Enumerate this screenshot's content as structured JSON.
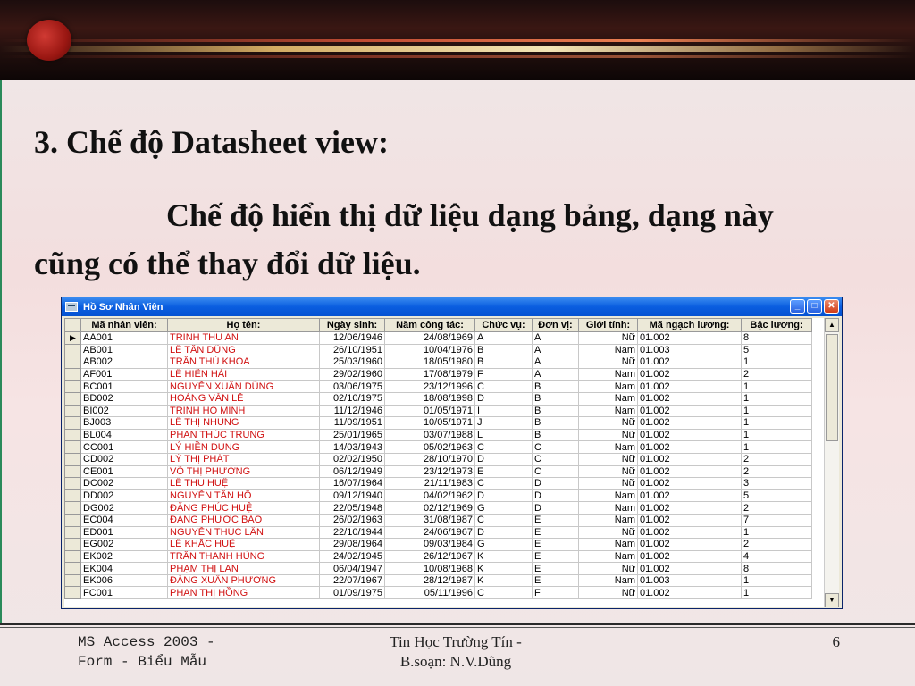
{
  "slide": {
    "heading": "3. Chế độ Datasheet view:",
    "paragraph": "Chế độ hiển thị dữ liệu dạng bảng, dạng này cũng có thể thay đổi dữ liệu."
  },
  "window": {
    "title": "Hồ Sơ Nhân Viên",
    "minimize": "_",
    "maximize": "□",
    "close": "✕",
    "columns": [
      "Mã nhân viên:",
      "Họ tên:",
      "Ngày sinh:",
      "Năm công tác:",
      "Chức vụ:",
      "Đơn vị:",
      "Giới tính:",
      "Mã ngạch lương:",
      "Bậc lương:"
    ],
    "current_row_marker": "▶",
    "rows": [
      [
        "AA001",
        "TRINH THU AN",
        "12/06/1946",
        "24/08/1969",
        "A",
        "A",
        "Nữ",
        "01.002",
        "8"
      ],
      [
        "AB001",
        "LÊ TẤN DŨNG",
        "26/10/1951",
        "10/04/1976",
        "B",
        "A",
        "Nam",
        "01.003",
        "5"
      ],
      [
        "AB002",
        "TRẦN THỦ KHOA",
        "25/03/1960",
        "18/05/1980",
        "B",
        "A",
        "Nữ",
        "01.002",
        "1"
      ],
      [
        "AF001",
        "LÊ HIỀN HẢI",
        "29/02/1960",
        "17/08/1979",
        "F",
        "A",
        "Nam",
        "01.002",
        "2"
      ],
      [
        "BC001",
        "NGUYỄN XUÂN DŨNG",
        "03/06/1975",
        "23/12/1996",
        "C",
        "B",
        "Nam",
        "01.002",
        "1"
      ],
      [
        "BD002",
        "HOÀNG VĂN LỄ",
        "02/10/1975",
        "18/08/1998",
        "D",
        "B",
        "Nam",
        "01.002",
        "1"
      ],
      [
        "BI002",
        "TRINH HỒ MINH",
        "11/12/1946",
        "01/05/1971",
        "I",
        "B",
        "Nam",
        "01.002",
        "1"
      ],
      [
        "BJ003",
        "LÊ THỊ NHUNG",
        "11/09/1951",
        "10/05/1971",
        "J",
        "B",
        "Nữ",
        "01.002",
        "1"
      ],
      [
        "BL004",
        "PHAN THÚC TRUNG",
        "25/01/1965",
        "03/07/1988",
        "L",
        "B",
        "Nữ",
        "01.002",
        "1"
      ],
      [
        "CC001",
        "LÝ HIỀN DUNG",
        "14/03/1943",
        "05/02/1963",
        "C",
        "C",
        "Nam",
        "01.002",
        "1"
      ],
      [
        "CD002",
        "LÝ THỊ PHÁT",
        "02/02/1950",
        "28/10/1970",
        "D",
        "C",
        "Nữ",
        "01.002",
        "2"
      ],
      [
        "CE001",
        "VÕ THỊ PHƯƠNG",
        "06/12/1949",
        "23/12/1973",
        "E",
        "C",
        "Nữ",
        "01.002",
        "2"
      ],
      [
        "DC002",
        "LÊ THU HUỆ",
        "16/07/1964",
        "21/11/1983",
        "C",
        "D",
        "Nữ",
        "01.002",
        "3"
      ],
      [
        "DD002",
        "NGUYỄN TẤN HỒ",
        "09/12/1940",
        "04/02/1962",
        "D",
        "D",
        "Nam",
        "01.002",
        "5"
      ],
      [
        "DG002",
        "ĐẶNG PHÚC HUỆ",
        "22/05/1948",
        "02/12/1969",
        "G",
        "D",
        "Nam",
        "01.002",
        "2"
      ],
      [
        "EC004",
        "ĐẶNG PHƯỚC BẢO",
        "26/02/1963",
        "31/08/1987",
        "C",
        "E",
        "Nam",
        "01.002",
        "7"
      ],
      [
        "ED001",
        "NGUYỄN THÚC LÂN",
        "22/10/1944",
        "24/06/1967",
        "D",
        "E",
        "Nữ",
        "01.002",
        "1"
      ],
      [
        "EG002",
        "LÊ KHẮC HUỆ",
        "29/08/1964",
        "09/03/1984",
        "G",
        "E",
        "Nam",
        "01.002",
        "2"
      ],
      [
        "EK002",
        "TRẦN THANH HÙNG",
        "24/02/1945",
        "26/12/1967",
        "K",
        "E",
        "Nam",
        "01.002",
        "4"
      ],
      [
        "EK004",
        "PHẠM THỊ LAN",
        "06/04/1947",
        "10/08/1968",
        "K",
        "E",
        "Nữ",
        "01.002",
        "8"
      ],
      [
        "EK006",
        "ĐẶNG XUÂN PHƯƠNG",
        "22/07/1967",
        "28/12/1987",
        "K",
        "E",
        "Nam",
        "01.003",
        "1"
      ],
      [
        "FC001",
        "PHAN THỊ HỒNG",
        "01/09/1975",
        "05/11/1996",
        "C",
        "F",
        "Nữ",
        "01.002",
        "1"
      ]
    ]
  },
  "footer": {
    "left_line1": "MS Access 2003 -",
    "left_line2": "Form - Biểu Mẫu",
    "mid_line1": "Tin Học Trường Tín -",
    "mid_line2": "B.soạn: N.V.Dũng",
    "page": "6"
  }
}
